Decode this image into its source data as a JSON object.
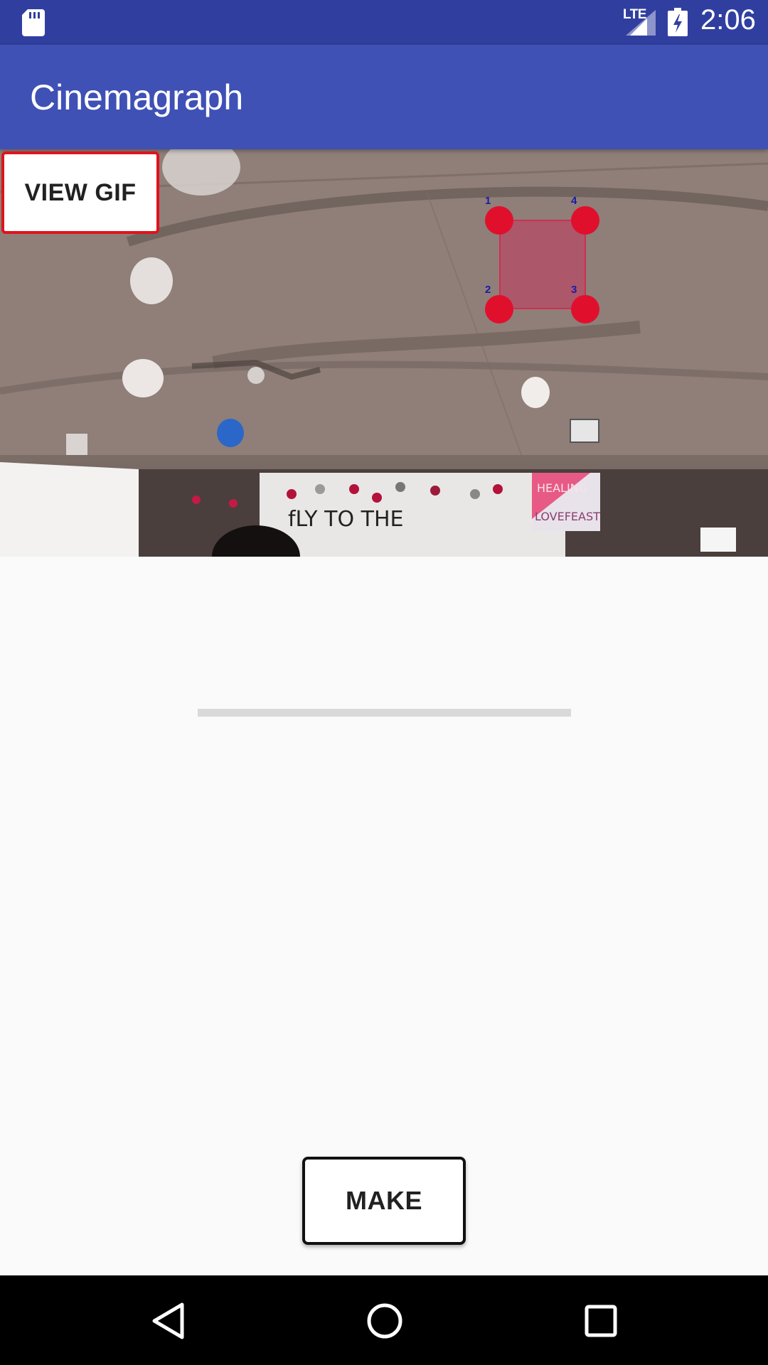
{
  "status_bar": {
    "time": "2:06",
    "network_label": "LTE",
    "icons": [
      "sd-card-icon",
      "signal-icon",
      "battery-charging-icon"
    ]
  },
  "app_bar": {
    "title": "Cinemagraph"
  },
  "video": {
    "view_gif_label": "VIEW GIF",
    "banner_text": "fLY TO THE",
    "sign_text": [
      "HEALING",
      "LOVEFEAST"
    ],
    "handles": [
      "1",
      "2",
      "3",
      "4"
    ]
  },
  "progress": {
    "value": 0
  },
  "actions": {
    "make_label": "MAKE"
  },
  "nav_bar": {
    "icons": [
      "back-icon",
      "home-icon",
      "recents-icon"
    ]
  },
  "colors": {
    "primary": "#3f51b5",
    "primary_dark": "#303f9f",
    "handle": "#e0102d",
    "view_gif_border": "#e0131c"
  }
}
